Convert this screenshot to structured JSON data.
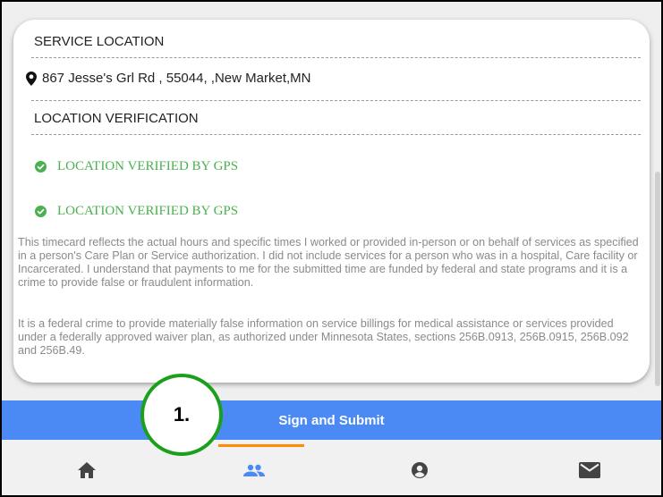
{
  "service_location": {
    "header": "SERVICE LOCATION",
    "address": "867 Jesse's Grl Rd , 55044, ,New Market,MN"
  },
  "location_verification": {
    "header": "LOCATION VERIFICATION",
    "items": [
      "LOCATION VERIFIED BY GPS",
      "LOCATION VERIFIED BY GPS"
    ]
  },
  "legal": {
    "paragraph1": "This timecard reflects the actual hours and specific times I worked or provided in-person or on behalf of services as specified in a person's Care Plan or Service authorization. I did not include services for a person who was in a hospital, Care facility or Incarcerated. I understand that payments to me for the submitted time are funded by federal and state programs and it is a crime to provide false or fraudulent information.",
    "paragraph2": "It is a federal crime to provide materially false information on service billings for medical assistance or services provided under a federally approved waiver plan, as authorized under Minnesota States, sections 256B.0913, 256B.0915, 256B.092 and 256B.49."
  },
  "submit_button": {
    "label": "Sign and Submit"
  },
  "annotation": {
    "label": "1."
  },
  "bottom_nav": {
    "items": [
      {
        "icon": "home-icon",
        "active": false
      },
      {
        "icon": "people-icon",
        "active": true
      },
      {
        "icon": "account-icon",
        "active": false
      },
      {
        "icon": "mail-icon",
        "active": false
      }
    ]
  },
  "colors": {
    "primary": "#4b89f5",
    "verified": "#4caf50",
    "active_tab": "#4b89f5",
    "active_indicator": "#ff8c00",
    "annotation_ring": "#1aa01a"
  }
}
